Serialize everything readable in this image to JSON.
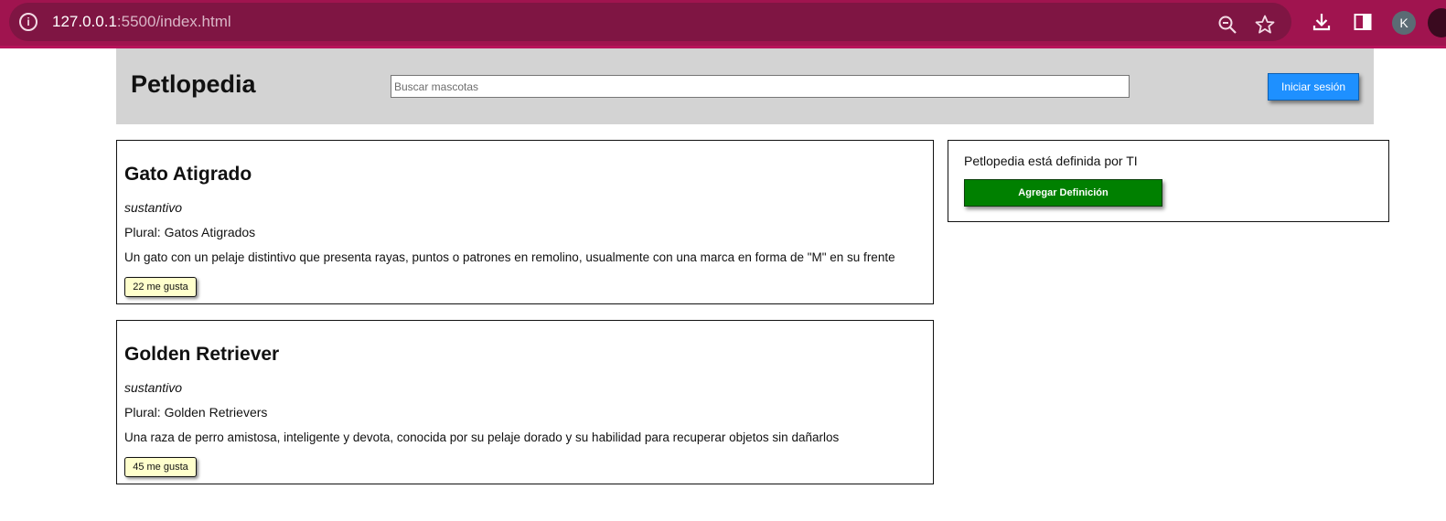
{
  "browser": {
    "url_host": "127.0.0.1",
    "url_rest": ":5500/index.html",
    "profile_initial": "K",
    "icons": [
      "info-icon",
      "zoom-icon",
      "bookmark-star-icon",
      "download-icon",
      "side-panel-icon"
    ]
  },
  "header": {
    "site_title": "Petlopedia",
    "search_placeholder": "Buscar mascotas",
    "login_label": "Iniciar sesión",
    "colors": {
      "header_bg": "#d3d3d3",
      "login_bg": "#1e90ff"
    }
  },
  "entries": [
    {
      "word": "Gato Atigrado",
      "type": "sustantivo",
      "plural": "Plural: Gatos Atigrados",
      "description": "Un gato con un pelaje distintivo que presenta rayas, puntos o patrones en remolino, usualmente con una marca en forma de \"M\" en su frente",
      "likes": "22 me gusta"
    },
    {
      "word": "Golden Retriever",
      "type": "sustantivo",
      "plural": "Plural: Golden Retrievers",
      "description": "Una raza de perro amistosa, inteligente y devota, conocida por su pelaje dorado y su habilidad para recuperar objetos sin dañarlos",
      "likes": "45 me gusta"
    }
  ],
  "sidebar": {
    "text": "Petlopedia está definida por TI",
    "add_label": "Agregar Definición",
    "colors": {
      "add_bg": "#008000",
      "like_bg": "#ffffcc"
    }
  }
}
